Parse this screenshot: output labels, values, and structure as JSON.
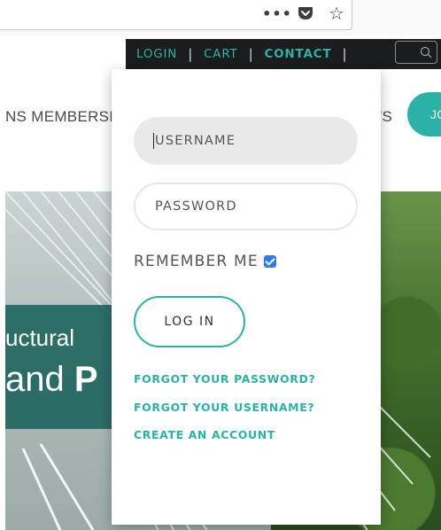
{
  "browser": {
    "icons": {
      "menu": "more-dots-icon",
      "pocket": "pocket-icon",
      "bookmark": "star-icon"
    }
  },
  "top_menu": {
    "login": "LOGIN",
    "cart": "CART",
    "contact": "CONTACT",
    "separator": "|",
    "search_icon": "search-icon"
  },
  "main_nav": {
    "left_fragment": "NS  MEMBERSI",
    "right_fragment": "'S",
    "join_fragment": "JO"
  },
  "hero": {
    "line1": "uctural",
    "line2_regular": "and ",
    "line2_bold": "P"
  },
  "login_form": {
    "username_placeholder": "USERNAME",
    "password_placeholder": "PASSWORD",
    "remember_label": "REMEMBER ME",
    "remember_checked": true,
    "login_button": "LOG IN",
    "forgot_password": "FORGOT YOUR PASSWORD?",
    "forgot_username": "FORGOT YOUR USERNAME?",
    "create_account": "CREATE AN ACCOUNT"
  },
  "colors": {
    "accent": "#2bb1a5",
    "top_menu_bg": "#1b1c1e",
    "checkbox": "#2f7fe0",
    "hero_band": "#19625a"
  }
}
